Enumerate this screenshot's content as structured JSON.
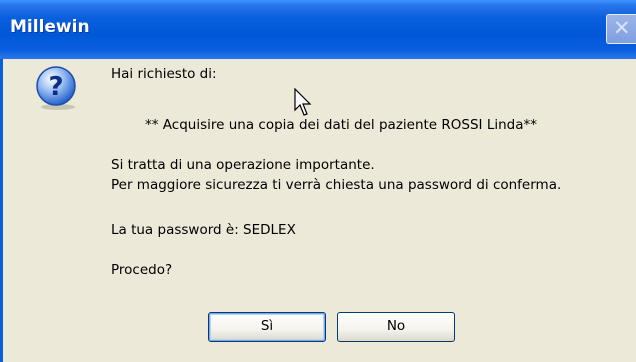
{
  "window": {
    "title": "Millewin",
    "close_glyph": "✕"
  },
  "dialog": {
    "icon": "question-icon",
    "line1": "Hai richiesto di:",
    "line2": "** Acquisire una copia dei dati del paziente ROSSI Linda**",
    "line3": "Si tratta di una operazione importante.",
    "line4": "Per maggiore sicurezza ti verrà chiesta una password di conferma.",
    "line5": "La tua password è:  SEDLEX",
    "line6": "Procedo?"
  },
  "buttons": {
    "yes_label": "Sì",
    "no_label": "No"
  },
  "colors": {
    "titlebar": "#0058d8",
    "dialog_bg": "#ece9d8",
    "icon_blue": "#1f5fc8"
  }
}
